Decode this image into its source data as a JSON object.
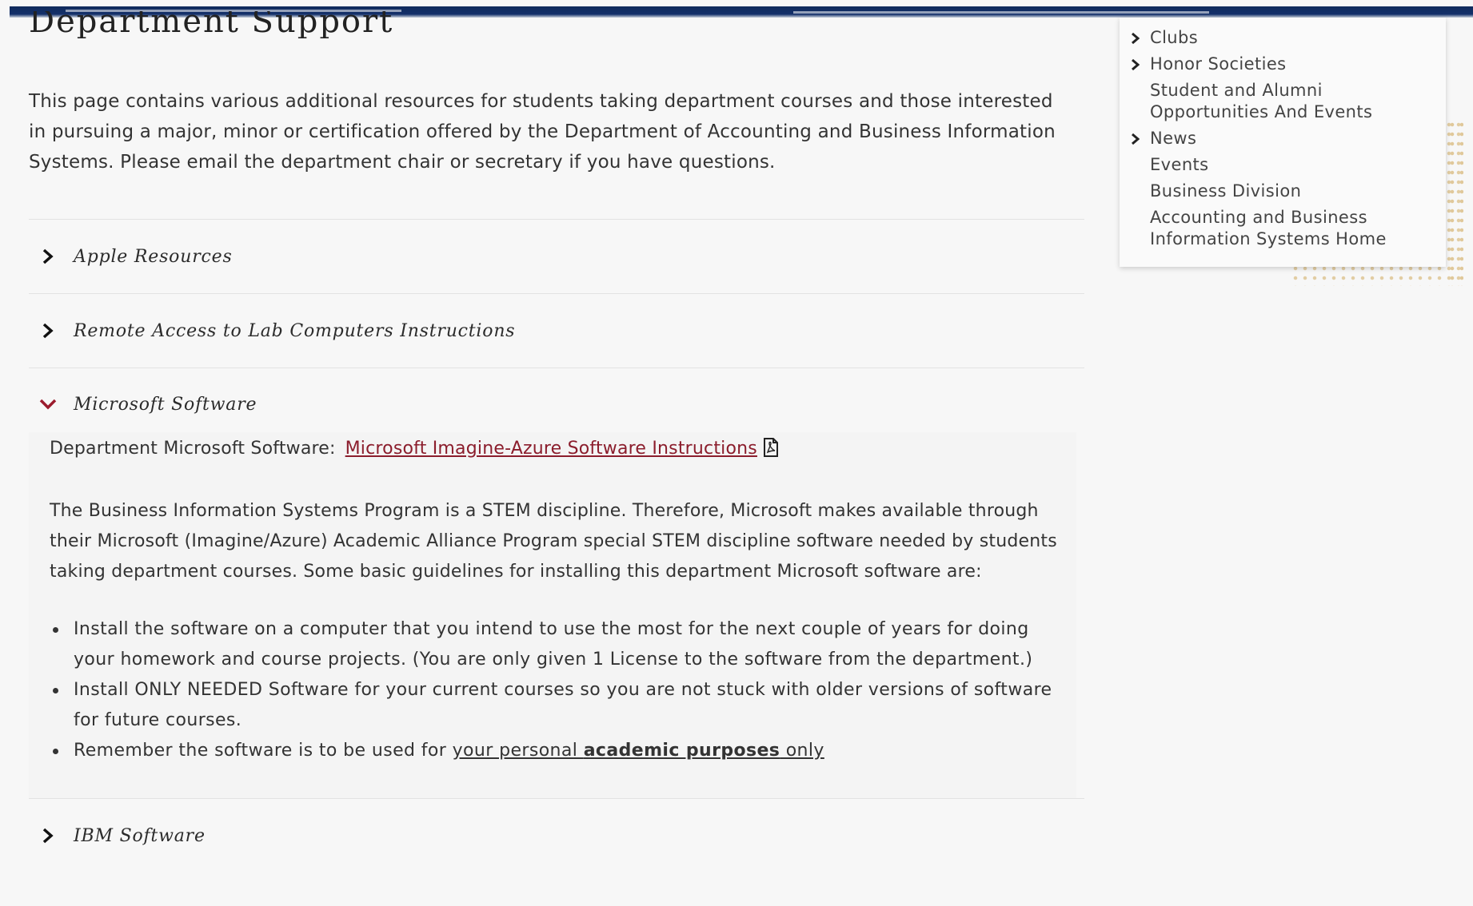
{
  "heading": {
    "fragment": "Department Support"
  },
  "intro": {
    "text": "This page contains various additional resources for students taking department courses and those interested in pursuing a major, minor or certification offered by the Department of Accounting and Business Information Systems.  Please email the department chair or secretary if you have questions."
  },
  "accordion": {
    "items": [
      {
        "label": "Apple Resources",
        "state": "collapsed"
      },
      {
        "label": "Remote Access to Lab Computers Instructions",
        "state": "collapsed"
      },
      {
        "label": "Microsoft Software",
        "state": "expanded"
      },
      {
        "label": "IBM Software",
        "state": "collapsed"
      }
    ],
    "microsoft": {
      "dept_label": "Department Microsoft Software:",
      "link_text": "Microsoft Imagine-Azure Software Instructions",
      "paragraph": "The Business Information Systems Program is a STEM discipline.  Therefore, Microsoft makes available through their Microsoft (Imagine/Azure) Academic Alliance Program special STEM discipline software needed by students taking department courses.  Some basic guidelines for installing this department Microsoft software are:",
      "bullets": [
        "Install the software on a computer that you intend to use the most for the next couple of years for doing your homework and course projects. (You are only given 1 License to the software from the department.)",
        "Install ONLY NEEDED Software for your current courses so you are not stuck with older versions of software for future courses."
      ],
      "bullet3": {
        "prefix": "Remember the software is to be used for ",
        "u1": "your personal ",
        "bold": "academic purposes",
        "u2": " only"
      }
    }
  },
  "sidebar": {
    "items": [
      {
        "label": "Clubs",
        "has_chevron": true
      },
      {
        "label": "Honor Societies",
        "has_chevron": true
      },
      {
        "label": "Student and Alumni Opportunities And Events",
        "has_chevron": false
      },
      {
        "label": "News",
        "has_chevron": true
      },
      {
        "label": "Events",
        "has_chevron": false
      },
      {
        "label": "Business Division",
        "has_chevron": false
      },
      {
        "label": "Accounting and Business Information Systems Home",
        "has_chevron": false
      }
    ]
  },
  "colors": {
    "navy": "#0f2a5c",
    "link": "#8b1d2c",
    "chevron_open": "#9b1b2d",
    "accent_gold": "#e0c89a"
  }
}
